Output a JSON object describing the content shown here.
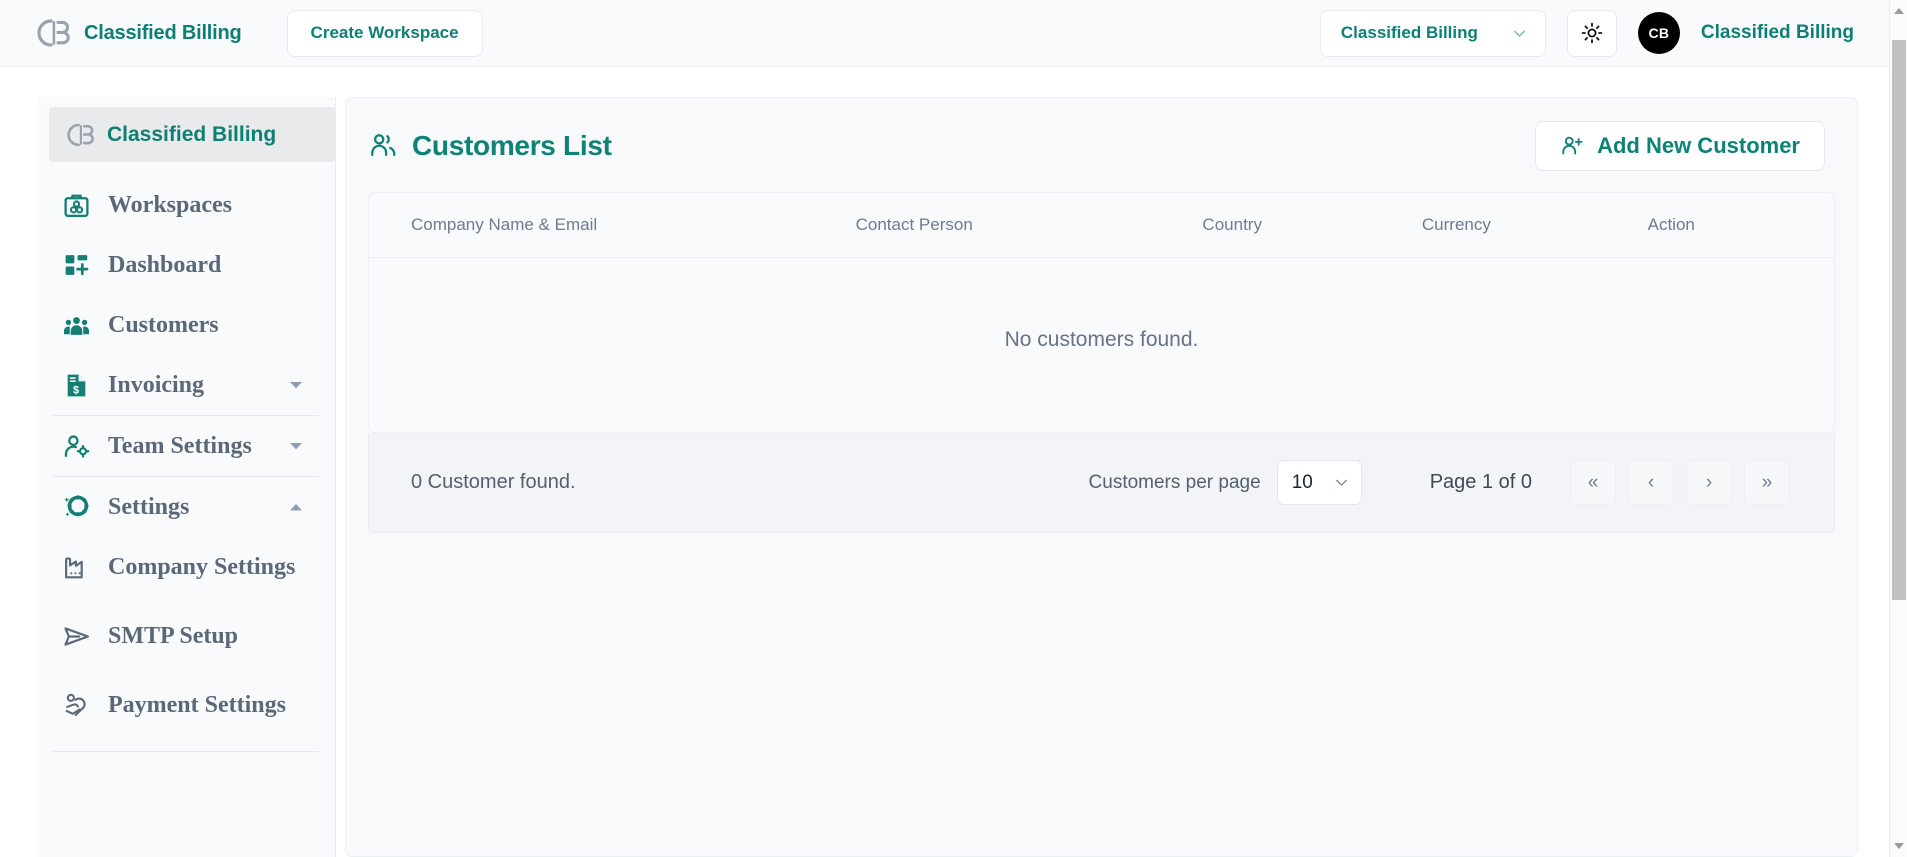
{
  "topbar": {
    "brand_name": "Classified Billing",
    "brand_logo_icon": "cb-logo-icon",
    "create_workspace_label": "Create Workspace",
    "workspace_select_value": "Classified Billing",
    "workspace_chevron_icon": "chevron-down-icon",
    "theme_toggle_icon": "sun-icon",
    "avatar_initials": "CB",
    "user_name": "Classified Billing"
  },
  "sidebar": {
    "header_label": "Classified Billing",
    "header_logo_icon": "cb-logo-icon",
    "items": [
      {
        "label": "Workspaces",
        "icon": "workspaces-icon",
        "caret": "",
        "divider_after": false,
        "gap_after": false
      },
      {
        "label": "Dashboard",
        "icon": "dashboard-icon",
        "caret": "",
        "divider_after": false,
        "gap_after": false
      },
      {
        "label": "Customers",
        "icon": "customers-icon",
        "caret": "",
        "divider_after": false,
        "gap_after": false
      },
      {
        "label": "Invoicing",
        "icon": "invoice-icon",
        "caret": "chevron-down-icon",
        "divider_after": true,
        "gap_after": false
      },
      {
        "label": "Team Settings",
        "icon": "team-settings-icon",
        "caret": "chevron-down-icon",
        "divider_after": true,
        "gap_after": false
      },
      {
        "label": "Settings",
        "icon": "gear-sparkle-icon",
        "caret": "chevron-up-icon",
        "divider_after": false,
        "gap_after": false
      },
      {
        "label": "Company Settings",
        "icon": "factory-icon",
        "caret": "",
        "divider_after": false,
        "gap_after": true
      },
      {
        "label": "SMTP Setup",
        "icon": "send-icon",
        "caret": "",
        "divider_after": false,
        "gap_after": true
      },
      {
        "label": "Payment Settings",
        "icon": "payment-hand-icon",
        "caret": "",
        "divider_after": true,
        "gap_after": false
      }
    ]
  },
  "main": {
    "page_title": "Customers List",
    "page_title_icon": "users-icon",
    "add_button_label": "Add New Customer",
    "add_button_icon": "user-plus-icon",
    "table": {
      "columns": [
        "Company Name & Email",
        "Contact Person",
        "Country",
        "Currency",
        "Action"
      ],
      "rows": [],
      "empty_message": "No customers found."
    },
    "pagination": {
      "count_text": "0 Customer found.",
      "per_page_label": "Customers per page",
      "per_page_value": "10",
      "per_page_chevron_icon": "chevron-down-icon",
      "page_of_text": "Page 1 of 0",
      "buttons": [
        {
          "glyph": "«",
          "name": "first-page-button"
        },
        {
          "glyph": "‹",
          "name": "prev-page-button"
        },
        {
          "glyph": "›",
          "name": "next-page-button"
        },
        {
          "glyph": "»",
          "name": "last-page-button"
        }
      ]
    }
  },
  "colors": {
    "accent_teal": "#0d8276",
    "brand_teal": "#0d7f73",
    "sidebar_bg": "#f8fafc",
    "nav_label": "#5b6878",
    "muted_text": "#6d7c8f",
    "avatar_bg": "#000000"
  }
}
